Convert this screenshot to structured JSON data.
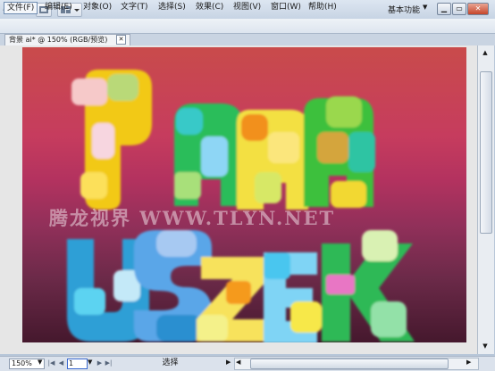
{
  "app": {
    "logo": "Ai",
    "workspace_label": "基本功能",
    "workspace_arrow": "▼"
  },
  "window_controls": {
    "minimize": "▁",
    "restore": "▭",
    "close": "✕"
  },
  "menu": [
    {
      "label": "文件(F)"
    },
    {
      "label": "编辑(E)"
    },
    {
      "label": "对象(O)"
    },
    {
      "label": "文字(T)"
    },
    {
      "label": "选择(S)"
    },
    {
      "label": "效果(C)"
    },
    {
      "label": "视图(V)"
    },
    {
      "label": "窗口(W)"
    },
    {
      "label": "帮助(H)"
    }
  ],
  "document": {
    "tab_title": "背景  ai* @ 150% (RGB/预览)",
    "tab_close": "✕"
  },
  "artwork": {
    "watermark": "腾龙视界 WWW.TLYN.NET"
  },
  "status": {
    "zoom": "150%",
    "zoom_arrow": "▼",
    "page": "1",
    "page_arrow": "▼",
    "first": "|◀",
    "prev": "◀",
    "next": "▶",
    "last": "▶|",
    "mode": "选择",
    "mode_arrow": "▶"
  },
  "scroll": {
    "up": "▲",
    "down": "▼",
    "left": "◀",
    "right": "▶"
  },
  "colors": {
    "accent": "#3c6ad0",
    "bg_top": "#c94b4b",
    "bg_bottom": "#45182d"
  }
}
